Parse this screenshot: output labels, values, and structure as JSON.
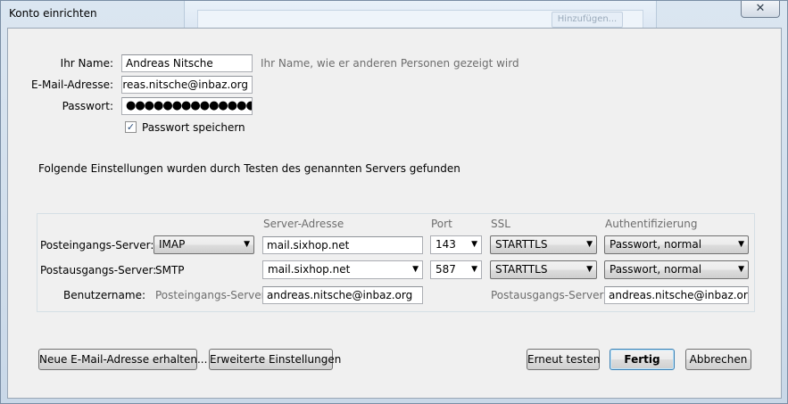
{
  "window": {
    "title": "Konto einrichten",
    "close_glyph": "✕",
    "background_button": "Hinzufügen..."
  },
  "account": {
    "name_label": "Ihr Name:",
    "name_value": "Andreas Nitsche",
    "name_hint": "Ihr Name, wie er anderen Personen gezeigt wird",
    "email_label": "E-Mail-Adresse:",
    "email_value": "andreas.nitsche@inbaz.org",
    "password_label": "Passwort:",
    "password_value": "●●●●●●●●●●●●●●●●●●●",
    "save_password_label": "Passwort speichern",
    "save_password_checked": true,
    "found_message": "Folgende Einstellungen wurden durch Testen des genannten Servers gefunden"
  },
  "servers": {
    "columns": {
      "address": "Server-Adresse",
      "port": "Port",
      "ssl": "SSL",
      "auth": "Authentifizierung"
    },
    "incoming": {
      "label": "Posteingangs-Server:",
      "protocol": "IMAP",
      "address": "mail.sixhop.net",
      "port": "143",
      "ssl": "STARTTLS",
      "auth": "Passwort, normal"
    },
    "outgoing": {
      "label": "Postausgangs-Server:",
      "protocol": "SMTP",
      "address": "mail.sixhop.net",
      "port": "587",
      "ssl": "STARTTLS",
      "auth": "Passwort, normal"
    },
    "username": {
      "label": "Benutzername:",
      "incoming_label": "Posteingangs-Server:",
      "incoming_value": "andreas.nitsche@inbaz.org",
      "outgoing_label": "Postausgangs-Server:",
      "outgoing_value": "andreas.nitsche@inbaz.org"
    }
  },
  "buttons": {
    "new_address": "Neue E-Mail-Adresse erhalten...",
    "advanced": "Erweiterte Einstellungen",
    "retest": "Erneut testen",
    "done": "Fertig",
    "cancel": "Abbrechen"
  },
  "icons": {
    "dropdown_arrow": "▼",
    "checkmark": "✓"
  }
}
